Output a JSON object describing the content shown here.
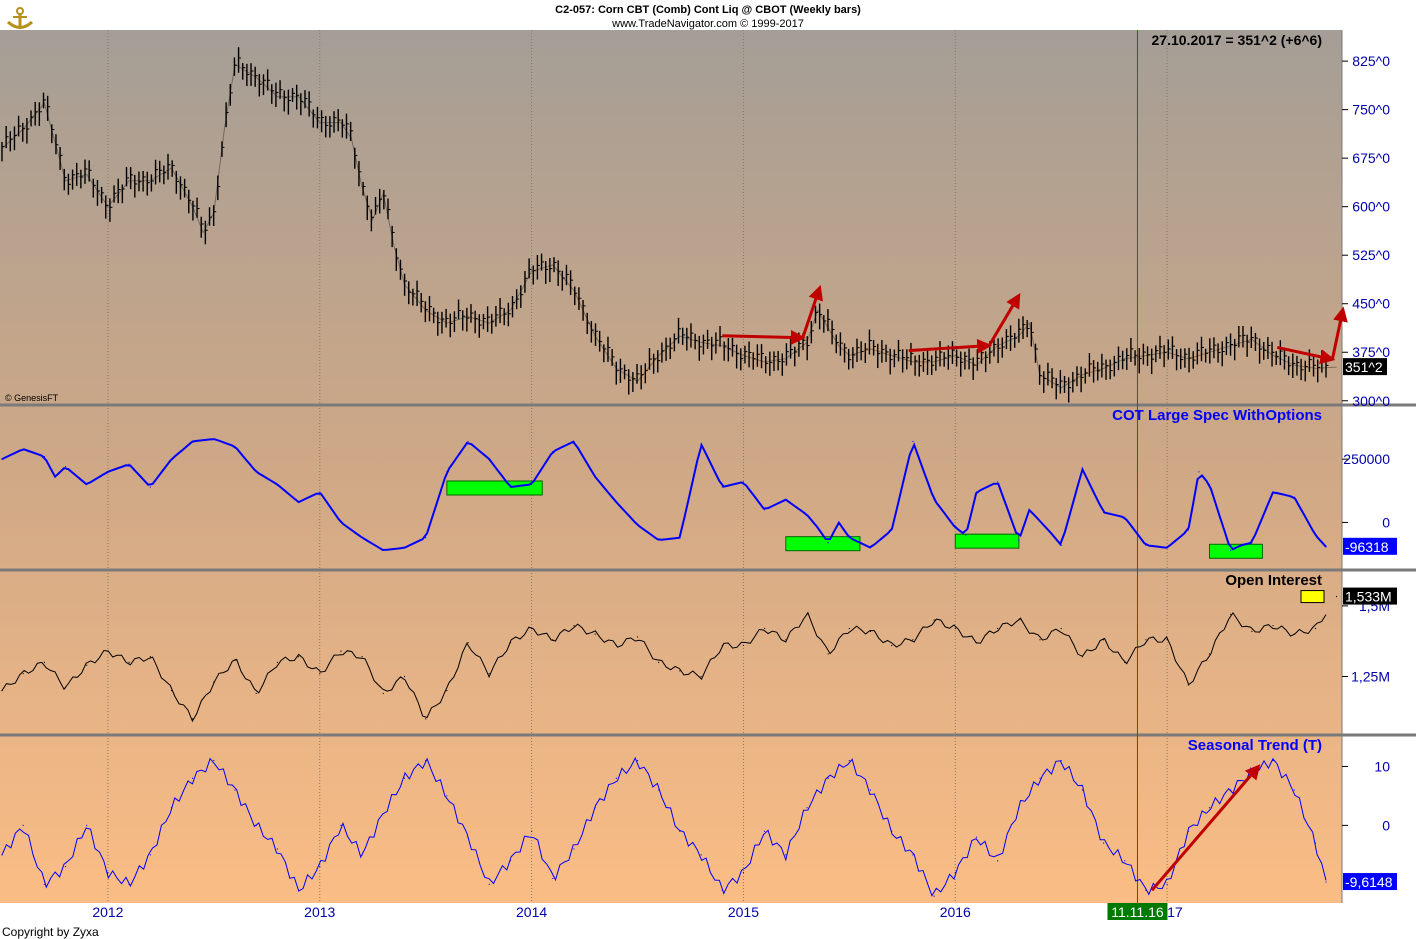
{
  "header": {
    "title": "C2-057:  Corn CBT (Comb) Cont Liq @ CBOT  (Weekly bars)",
    "source": "www.TradeNavigator.com © 1999-2017"
  },
  "footer": {
    "copyright": "Copyright by Zyxa",
    "vendor": "© GenesisFT"
  },
  "colors": {
    "price_bars": "#000000",
    "cot_line": "#0000ff",
    "seasonal_line": "#0000ff",
    "oi_line": "#000000",
    "arrows": "#c00000",
    "highlight_boxes": "#00ff00",
    "cursor_line": "#008000"
  },
  "chart_data": [
    {
      "type": "line",
      "panel": "price",
      "title": "",
      "readout": "27.10.2017 = 351^2 (+6^6)",
      "last_value_label": "351^2",
      "y_ticks": [
        "825^0",
        "750^0",
        "675^0",
        "600^0",
        "525^0",
        "450^0",
        "375^0",
        "300^0"
      ],
      "ylim": [
        295,
        870
      ],
      "x_ticks": [
        "2012",
        "2013",
        "2014",
        "2015",
        "2016",
        "2017"
      ],
      "x": [
        2011.5,
        2011.6,
        2011.7,
        2011.8,
        2011.9,
        2012.0,
        2012.1,
        2012.2,
        2012.3,
        2012.4,
        2012.45,
        2012.5,
        2012.55,
        2012.6,
        2012.7,
        2012.8,
        2012.9,
        2013.0,
        2013.1,
        2013.15,
        2013.2,
        2013.25,
        2013.3,
        2013.35,
        2013.4,
        2013.5,
        2013.6,
        2013.7,
        2013.8,
        2013.9,
        2014.0,
        2014.1,
        2014.2,
        2014.3,
        2014.4,
        2014.5,
        2014.6,
        2014.7,
        2014.8,
        2014.9,
        2015.0,
        2015.1,
        2015.2,
        2015.3,
        2015.35,
        2015.45,
        2015.5,
        2015.6,
        2015.7,
        2015.8,
        2015.9,
        2016.0,
        2016.1,
        2016.2,
        2016.3,
        2016.35,
        2016.4,
        2016.5,
        2016.6,
        2016.7,
        2016.8,
        2016.9,
        2017.0,
        2017.1,
        2017.2,
        2017.3,
        2017.4,
        2017.5,
        2017.6,
        2017.7,
        2017.8
      ],
      "y": [
        690,
        720,
        760,
        640,
        650,
        600,
        640,
        640,
        660,
        600,
        560,
        590,
        720,
        820,
        800,
        770,
        770,
        730,
        730,
        705,
        630,
        580,
        620,
        540,
        480,
        440,
        420,
        430,
        420,
        440,
        500,
        510,
        470,
        400,
        350,
        330,
        370,
        400,
        390,
        385,
        370,
        360,
        365,
        390,
        440,
        385,
        370,
        380,
        370,
        360,
        360,
        370,
        355,
        385,
        400,
        420,
        340,
        320,
        340,
        350,
        365,
        370,
        375,
        365,
        375,
        385,
        395,
        370,
        355,
        350,
        352
      ],
      "annotations": [
        "down-up arrow 2015",
        "down-up arrow 2016",
        "down-up arrow 2017"
      ]
    },
    {
      "type": "line",
      "panel": "cot",
      "title": "COT Large Spec WithOptions",
      "last_value_label": "-96318",
      "y_ticks": [
        "250000",
        "0"
      ],
      "ylim": [
        -180000,
        460000
      ],
      "x": [
        2011.5,
        2011.6,
        2011.7,
        2011.75,
        2011.8,
        2011.9,
        2012.0,
        2012.1,
        2012.2,
        2012.3,
        2012.4,
        2012.5,
        2012.6,
        2012.7,
        2012.8,
        2012.9,
        2013.0,
        2013.1,
        2013.2,
        2013.3,
        2013.4,
        2013.5,
        2013.6,
        2013.7,
        2013.8,
        2013.9,
        2014.0,
        2014.1,
        2014.2,
        2014.3,
        2014.4,
        2014.5,
        2014.6,
        2014.7,
        2014.8,
        2014.9,
        2015.0,
        2015.1,
        2015.2,
        2015.3,
        2015.35,
        2015.4,
        2015.45,
        2015.5,
        2015.6,
        2015.7,
        2015.8,
        2015.9,
        2016.0,
        2016.05,
        2016.1,
        2016.2,
        2016.3,
        2016.35,
        2016.45,
        2016.5,
        2016.6,
        2016.7,
        2016.8,
        2016.9,
        2017.0,
        2017.1,
        2017.15,
        2017.2,
        2017.3,
        2017.35,
        2017.4,
        2017.5,
        2017.6,
        2017.7,
        2017.75
      ],
      "y": [
        250000,
        290000,
        260000,
        180000,
        220000,
        150000,
        200000,
        230000,
        140000,
        250000,
        320000,
        330000,
        300000,
        200000,
        150000,
        80000,
        120000,
        0,
        -60000,
        -110000,
        -100000,
        -60000,
        200000,
        320000,
        250000,
        140000,
        150000,
        280000,
        320000,
        180000,
        80000,
        -10000,
        -70000,
        -60000,
        310000,
        140000,
        160000,
        50000,
        90000,
        30000,
        -20000,
        -80000,
        0,
        -60000,
        -100000,
        -30000,
        320000,
        90000,
        -20000,
        -50000,
        120000,
        160000,
        -70000,
        50000,
        -40000,
        -90000,
        210000,
        40000,
        20000,
        -90000,
        -100000,
        -30000,
        200000,
        150000,
        -110000,
        -90000,
        -80000,
        120000,
        100000,
        -50000,
        -96318
      ],
      "highlights": [
        "2013.6-2014.05",
        "2015.2-2015.55",
        "2016.0-2016.3",
        "2017.2-2017.45"
      ]
    },
    {
      "type": "line",
      "panel": "open_interest",
      "title": "Open Interest",
      "last_value_label": "1,533M",
      "y_ticks": [
        "1,5M",
        "1,25M"
      ],
      "ylim": [
        1050000,
        1620000
      ],
      "x": [
        2011.5,
        2011.6,
        2011.7,
        2011.8,
        2011.9,
        2012.0,
        2012.1,
        2012.2,
        2012.3,
        2012.4,
        2012.5,
        2012.6,
        2012.7,
        2012.8,
        2012.9,
        2013.0,
        2013.1,
        2013.2,
        2013.3,
        2013.4,
        2013.5,
        2013.6,
        2013.7,
        2013.8,
        2013.9,
        2014.0,
        2014.1,
        2014.2,
        2014.3,
        2014.4,
        2014.5,
        2014.6,
        2014.7,
        2014.8,
        2014.9,
        2015.0,
        2015.1,
        2015.2,
        2015.3,
        2015.4,
        2015.5,
        2015.6,
        2015.7,
        2015.8,
        2015.9,
        2016.0,
        2016.1,
        2016.2,
        2016.3,
        2016.4,
        2016.5,
        2016.6,
        2016.7,
        2016.8,
        2016.9,
        2017.0,
        2017.1,
        2017.2,
        2017.3,
        2017.4,
        2017.5,
        2017.6,
        2017.7,
        2017.8
      ],
      "y": [
        1200000,
        1260000,
        1300000,
        1210000,
        1290000,
        1340000,
        1300000,
        1320000,
        1200000,
        1100000,
        1230000,
        1310000,
        1190000,
        1300000,
        1320000,
        1260000,
        1340000,
        1320000,
        1190000,
        1250000,
        1100000,
        1200000,
        1370000,
        1260000,
        1370000,
        1420000,
        1380000,
        1430000,
        1400000,
        1360000,
        1390000,
        1300000,
        1270000,
        1250000,
        1360000,
        1360000,
        1420000,
        1380000,
        1470000,
        1330000,
        1420000,
        1410000,
        1360000,
        1380000,
        1450000,
        1420000,
        1370000,
        1420000,
        1450000,
        1380000,
        1420000,
        1320000,
        1380000,
        1300000,
        1380000,
        1380000,
        1220000,
        1330000,
        1470000,
        1410000,
        1430000,
        1400000,
        1420000,
        1533000
      ],
      "annotations": [
        "yellow marker at last bar"
      ]
    },
    {
      "type": "line",
      "panel": "seasonal",
      "title": "Seasonal Trend (T)",
      "last_value_label": "-9,6148",
      "cursor_date": "11.11.16",
      "y_ticks": [
        "10",
        "0"
      ],
      "ylim": [
        -13,
        15
      ],
      "x": [
        2011.5,
        2011.6,
        2011.7,
        2011.8,
        2011.9,
        2012.0,
        2012.1,
        2012.2,
        2012.3,
        2012.4,
        2012.5,
        2012.6,
        2012.7,
        2012.8,
        2012.9,
        2013.0,
        2013.1,
        2013.2,
        2013.3,
        2013.4,
        2013.5,
        2013.6,
        2013.7,
        2013.8,
        2013.9,
        2014.0,
        2014.1,
        2014.2,
        2014.3,
        2014.4,
        2014.5,
        2014.6,
        2014.7,
        2014.8,
        2014.9,
        2015.0,
        2015.1,
        2015.2,
        2015.3,
        2015.4,
        2015.5,
        2015.6,
        2015.7,
        2015.8,
        2015.9,
        2016.0,
        2016.1,
        2016.2,
        2016.3,
        2016.4,
        2016.5,
        2016.6,
        2016.7,
        2016.8,
        2016.9,
        2017.0,
        2017.1,
        2017.2,
        2017.3,
        2017.4,
        2017.5,
        2017.6,
        2017.7,
        2017.75
      ],
      "y": [
        -5,
        0,
        -10,
        -7,
        0,
        -8,
        -10,
        -5,
        3,
        8,
        11,
        6,
        0,
        -4,
        -11,
        -7,
        0,
        -5,
        2,
        8,
        11,
        5,
        -2,
        -10,
        -6,
        -1,
        -9,
        -4,
        3,
        8,
        11,
        6,
        -1,
        -5,
        -11,
        -8,
        -1,
        -5,
        3,
        8,
        11,
        6,
        -1,
        -5,
        -12,
        -8,
        -2,
        -6,
        3,
        8,
        11,
        6,
        -3,
        -6,
        -11,
        -10,
        -1,
        3,
        6,
        9,
        11,
        6,
        -3,
        -9.6148
      ],
      "annotations": [
        "up arrow 2016.9-2017.45"
      ]
    }
  ]
}
